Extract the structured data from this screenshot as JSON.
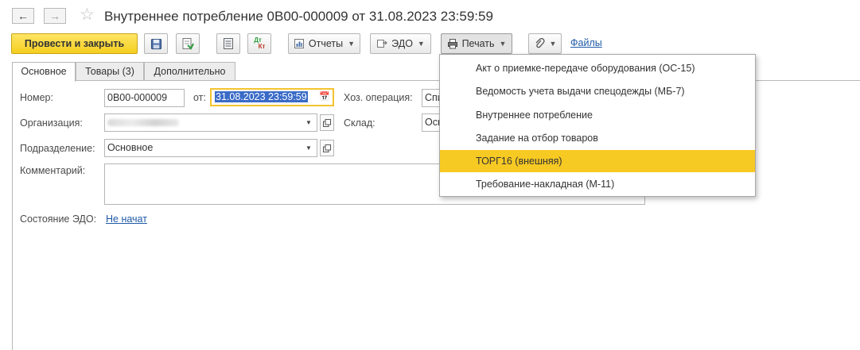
{
  "header": {
    "title": "Внутреннее потребление 0В00-000009 от 31.08.2023 23:59:59",
    "back_icon": "arrow-left-icon",
    "forward_icon": "arrow-right-icon",
    "favorite_icon": "star-icon"
  },
  "toolbar": {
    "post_close_label": "Провести и закрыть",
    "dtkt_label_top": "Дт",
    "dtkt_label_bottom": "Кт",
    "reports_label": "Отчеты",
    "edo_label": "ЭДО",
    "print_label": "Печать",
    "files_label": "Файлы",
    "accent_color": "#f5cf1f"
  },
  "tabs": [
    {
      "label": "Основное",
      "active": true
    },
    {
      "label": "Товары (3)",
      "active": false
    },
    {
      "label": "Дополнительно",
      "active": false
    }
  ],
  "form": {
    "number_label": "Номер:",
    "number_value": "0В00-000009",
    "date_label": "от:",
    "date_value": "31.08.2023 23:59:59",
    "operation_label": "Хоз. операция:",
    "operation_value": "Спи",
    "organization_label": "Организация:",
    "warehouse_label": "Склад:",
    "warehouse_value": "Осн",
    "division_label": "Подразделение:",
    "division_value": "Основное",
    "comment_label": "Комментарий:",
    "comment_value": "",
    "edo_state_label": "Состояние ЭДО:",
    "edo_state_value": "Не начат"
  },
  "print_menu": {
    "items": [
      {
        "label": "Акт о приемке-передаче оборудования (ОС-15)",
        "highlighted": false
      },
      {
        "label": "Ведомость учета выдачи спецодежды (МБ-7)",
        "highlighted": false
      },
      {
        "label": "Внутреннее потребление",
        "highlighted": false
      },
      {
        "label": "Задание на отбор товаров",
        "highlighted": false
      },
      {
        "label": "ТОРГ16 (внешняя)",
        "highlighted": true
      },
      {
        "label": "Требование-накладная (М-11)",
        "highlighted": false
      }
    ],
    "highlight_color": "#f7c923"
  }
}
